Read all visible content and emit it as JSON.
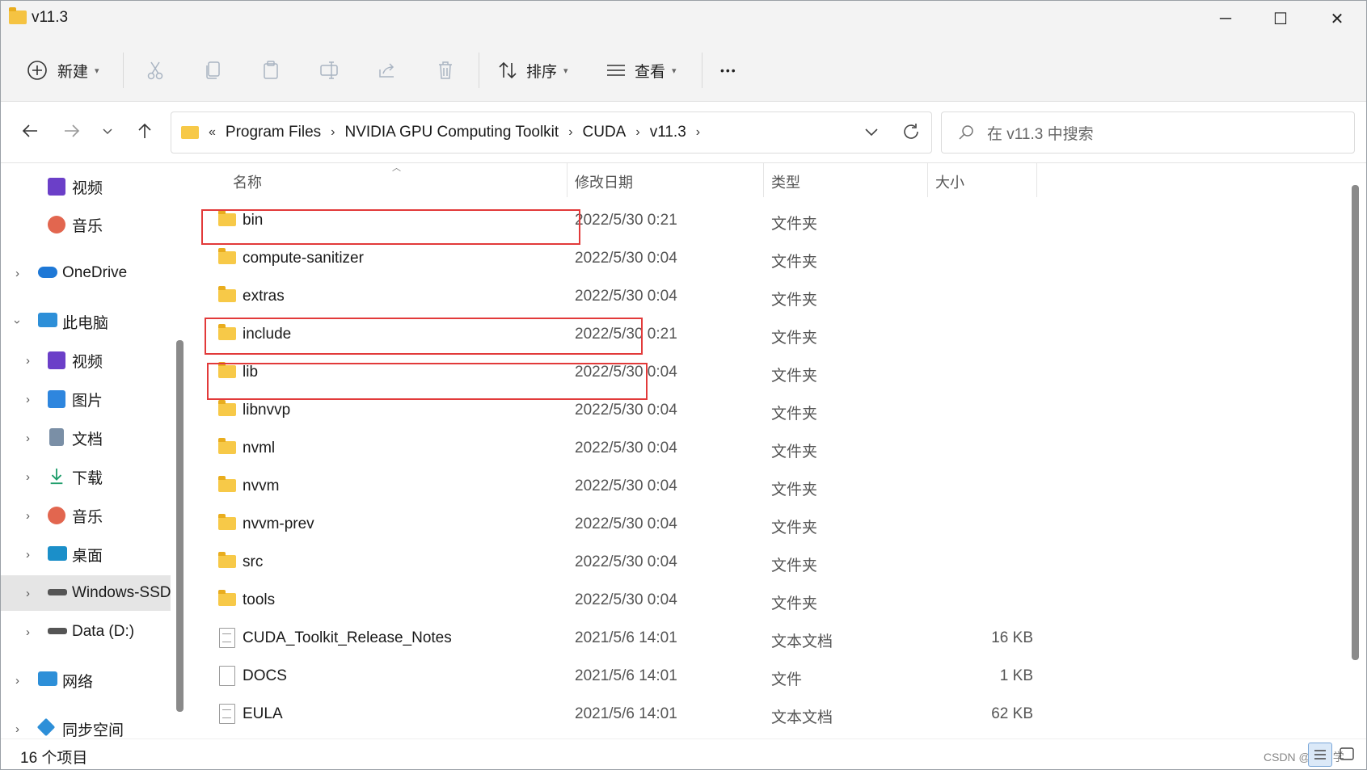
{
  "window": {
    "title": "v11.3",
    "minimize_glyph": "─",
    "maximize_glyph": "☐",
    "close_glyph": "✕"
  },
  "toolbar": {
    "new_label": "新建",
    "sort_label": "排序",
    "view_label": "查看",
    "more_glyph": "•••",
    "icons": [
      "cut-icon",
      "copy-icon",
      "paste-icon",
      "rename-icon",
      "share-icon",
      "delete-icon"
    ]
  },
  "address": {
    "overflow": "«",
    "crumbs": [
      "Program Files",
      "NVIDIA GPU Computing Toolkit",
      "CUDA",
      "v11.3"
    ],
    "search_placeholder": "在 v11.3 中搜索"
  },
  "sidebar": {
    "items": [
      {
        "label": "视频",
        "icon": "video-icon",
        "color": "#6b3fc8"
      },
      {
        "label": "音乐",
        "icon": "music-icon",
        "color": "#e2664f"
      },
      {
        "label": "OneDrive",
        "icon": "onedrive-icon",
        "color": "#1e78d6"
      },
      {
        "label": "此电脑",
        "icon": "computer-icon",
        "color": "#2d8fd8"
      },
      {
        "label": "视频",
        "icon": "video-icon",
        "color": "#6b3fc8"
      },
      {
        "label": "图片",
        "icon": "pictures-icon",
        "color": "#2e86de"
      },
      {
        "label": "文档",
        "icon": "documents-icon",
        "color": "#7a8fa6"
      },
      {
        "label": "下载",
        "icon": "download-icon",
        "color": "#1f9d6b"
      },
      {
        "label": "音乐",
        "icon": "music-icon",
        "color": "#e2664f"
      },
      {
        "label": "桌面",
        "icon": "desktop-icon",
        "color": "#1b8fc9"
      },
      {
        "label": "Windows-SSD",
        "icon": "drive-icon",
        "color": "#555555"
      },
      {
        "label": "Data (D:)",
        "icon": "drive-icon",
        "color": "#555555"
      },
      {
        "label": "网络",
        "icon": "network-icon",
        "color": "#2d8fd8"
      },
      {
        "label": "同步空间",
        "icon": "sync-icon",
        "color": "#2d8fd8"
      }
    ]
  },
  "columns": {
    "name": "名称",
    "date": "修改日期",
    "type": "类型",
    "size": "大小"
  },
  "files": [
    {
      "name": "bin",
      "date": "2022/5/30 0:21",
      "type": "文件夹",
      "size": "",
      "kind": "folder"
    },
    {
      "name": "compute-sanitizer",
      "date": "2022/5/30 0:04",
      "type": "文件夹",
      "size": "",
      "kind": "folder"
    },
    {
      "name": "extras",
      "date": "2022/5/30 0:04",
      "type": "文件夹",
      "size": "",
      "kind": "folder"
    },
    {
      "name": "include",
      "date": "2022/5/30 0:21",
      "type": "文件夹",
      "size": "",
      "kind": "folder"
    },
    {
      "name": "lib",
      "date": "2022/5/30 0:04",
      "type": "文件夹",
      "size": "",
      "kind": "folder"
    },
    {
      "name": "libnvvp",
      "date": "2022/5/30 0:04",
      "type": "文件夹",
      "size": "",
      "kind": "folder"
    },
    {
      "name": "nvml",
      "date": "2022/5/30 0:04",
      "type": "文件夹",
      "size": "",
      "kind": "folder"
    },
    {
      "name": "nvvm",
      "date": "2022/5/30 0:04",
      "type": "文件夹",
      "size": "",
      "kind": "folder"
    },
    {
      "name": "nvvm-prev",
      "date": "2022/5/30 0:04",
      "type": "文件夹",
      "size": "",
      "kind": "folder"
    },
    {
      "name": "src",
      "date": "2022/5/30 0:04",
      "type": "文件夹",
      "size": "",
      "kind": "folder"
    },
    {
      "name": "tools",
      "date": "2022/5/30 0:04",
      "type": "文件夹",
      "size": "",
      "kind": "folder"
    },
    {
      "name": "CUDA_Toolkit_Release_Notes",
      "date": "2021/5/6 14:01",
      "type": "文本文档",
      "size": "16 KB",
      "kind": "text"
    },
    {
      "name": "DOCS",
      "date": "2021/5/6 14:01",
      "type": "文件",
      "size": "1 KB",
      "kind": "file"
    },
    {
      "name": "EULA",
      "date": "2021/5/6 14:01",
      "type": "文本文档",
      "size": "62 KB",
      "kind": "text"
    }
  ],
  "status": {
    "item_count": "16 个项目",
    "watermark": "CSDN @舒同学"
  },
  "colors": {
    "highlight": "#e23a3a",
    "folder": "#f7c948",
    "accent": "#0067c0"
  }
}
